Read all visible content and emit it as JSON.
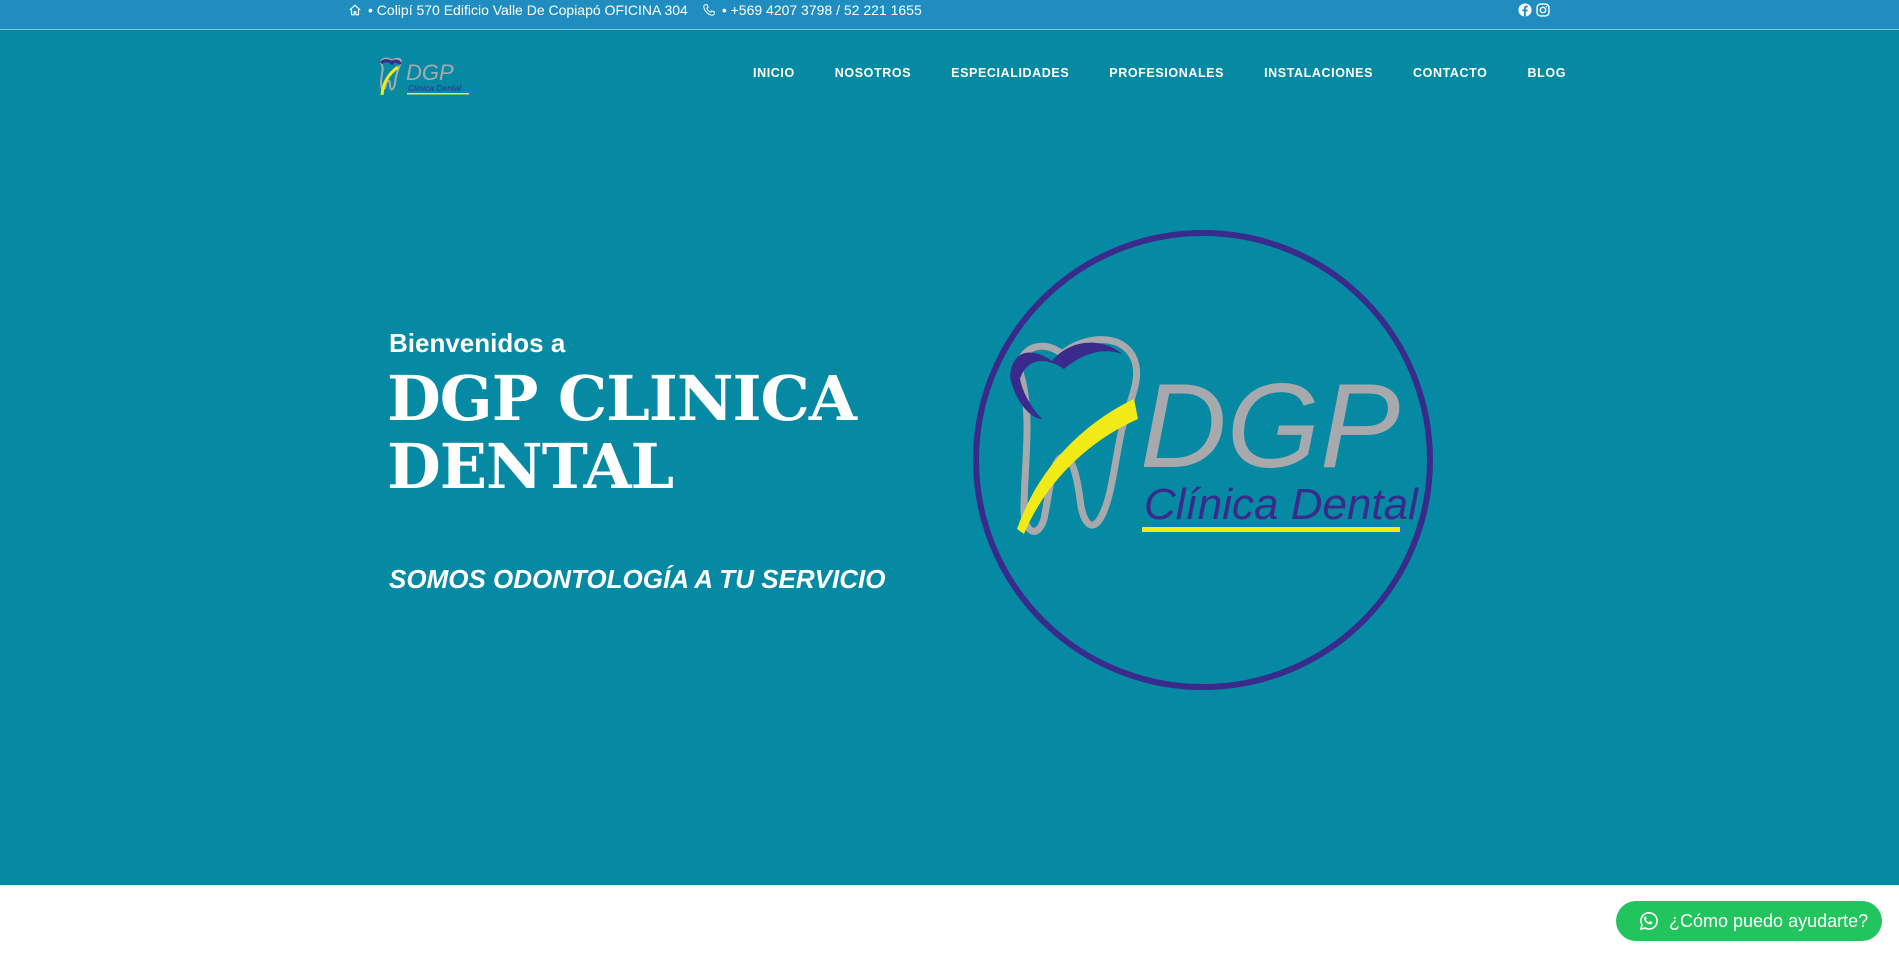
{
  "topbar": {
    "address": "• Colipí 570 Edificio Valle De Copiapó OFICINA 304",
    "phone": "• +569 4207 3798 / 52 221 1655",
    "social": [
      "facebook-icon",
      "instagram-icon"
    ]
  },
  "nav": {
    "items": [
      "INICIO",
      "NOSOTROS",
      "ESPECIALIDADES",
      "PROFESIONALES",
      "INSTALACIONES",
      "CONTACTO",
      "BLOG"
    ]
  },
  "logo": {
    "brand": "DGP",
    "tagline": "Clínica Dental"
  },
  "hero": {
    "welcome": "Bienvenidos a",
    "title": "DGP CLINICA DENTAL",
    "subtitle": "SOMOS ODONTOLOGÍA A TU SERVICIO"
  },
  "chat_widget": {
    "label": "¿Cómo puedo ayudarte?"
  },
  "colors": {
    "topbar": "#1f8dbf",
    "header": "#0689a3",
    "logo_purple": "#3a2a8c",
    "logo_yellow": "#f2ea16",
    "logo_grey": "#a7a9ac",
    "whatsapp": "#22c45e"
  }
}
